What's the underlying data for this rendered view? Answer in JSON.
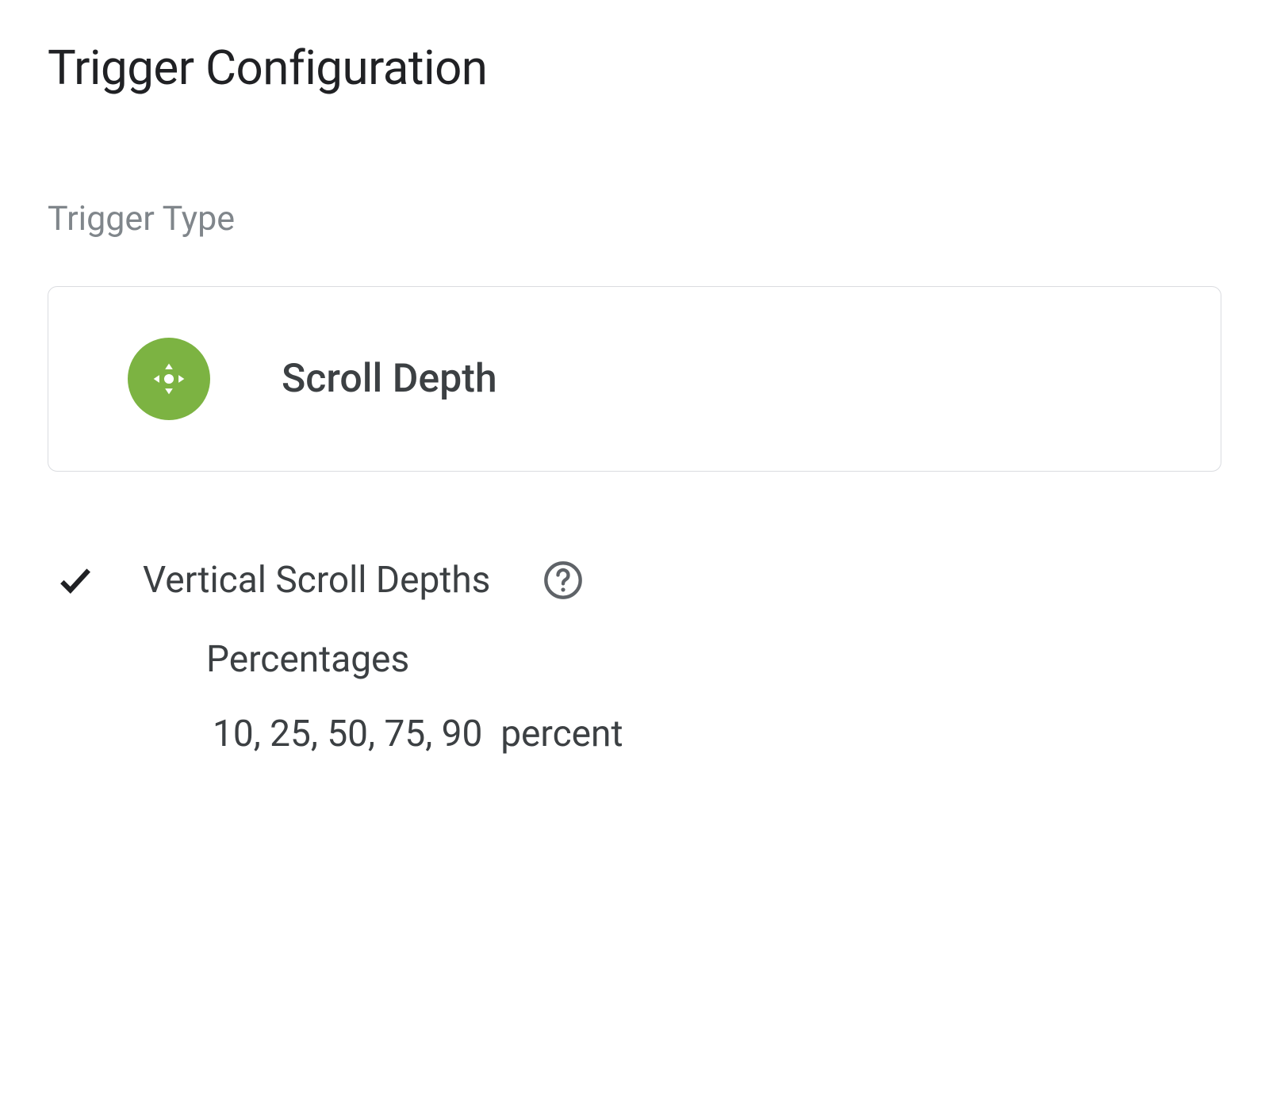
{
  "section": {
    "title": "Trigger Configuration"
  },
  "triggerType": {
    "label": "Trigger Type",
    "name": "Scroll Depth",
    "iconName": "scroll-depth-icon"
  },
  "options": {
    "verticalScrollDepths": {
      "label": "Vertical Scroll Depths",
      "checked": true,
      "subOption": {
        "label": "Percentages",
        "value": "10, 25, 50, 75, 90",
        "unit": "percent"
      }
    }
  }
}
